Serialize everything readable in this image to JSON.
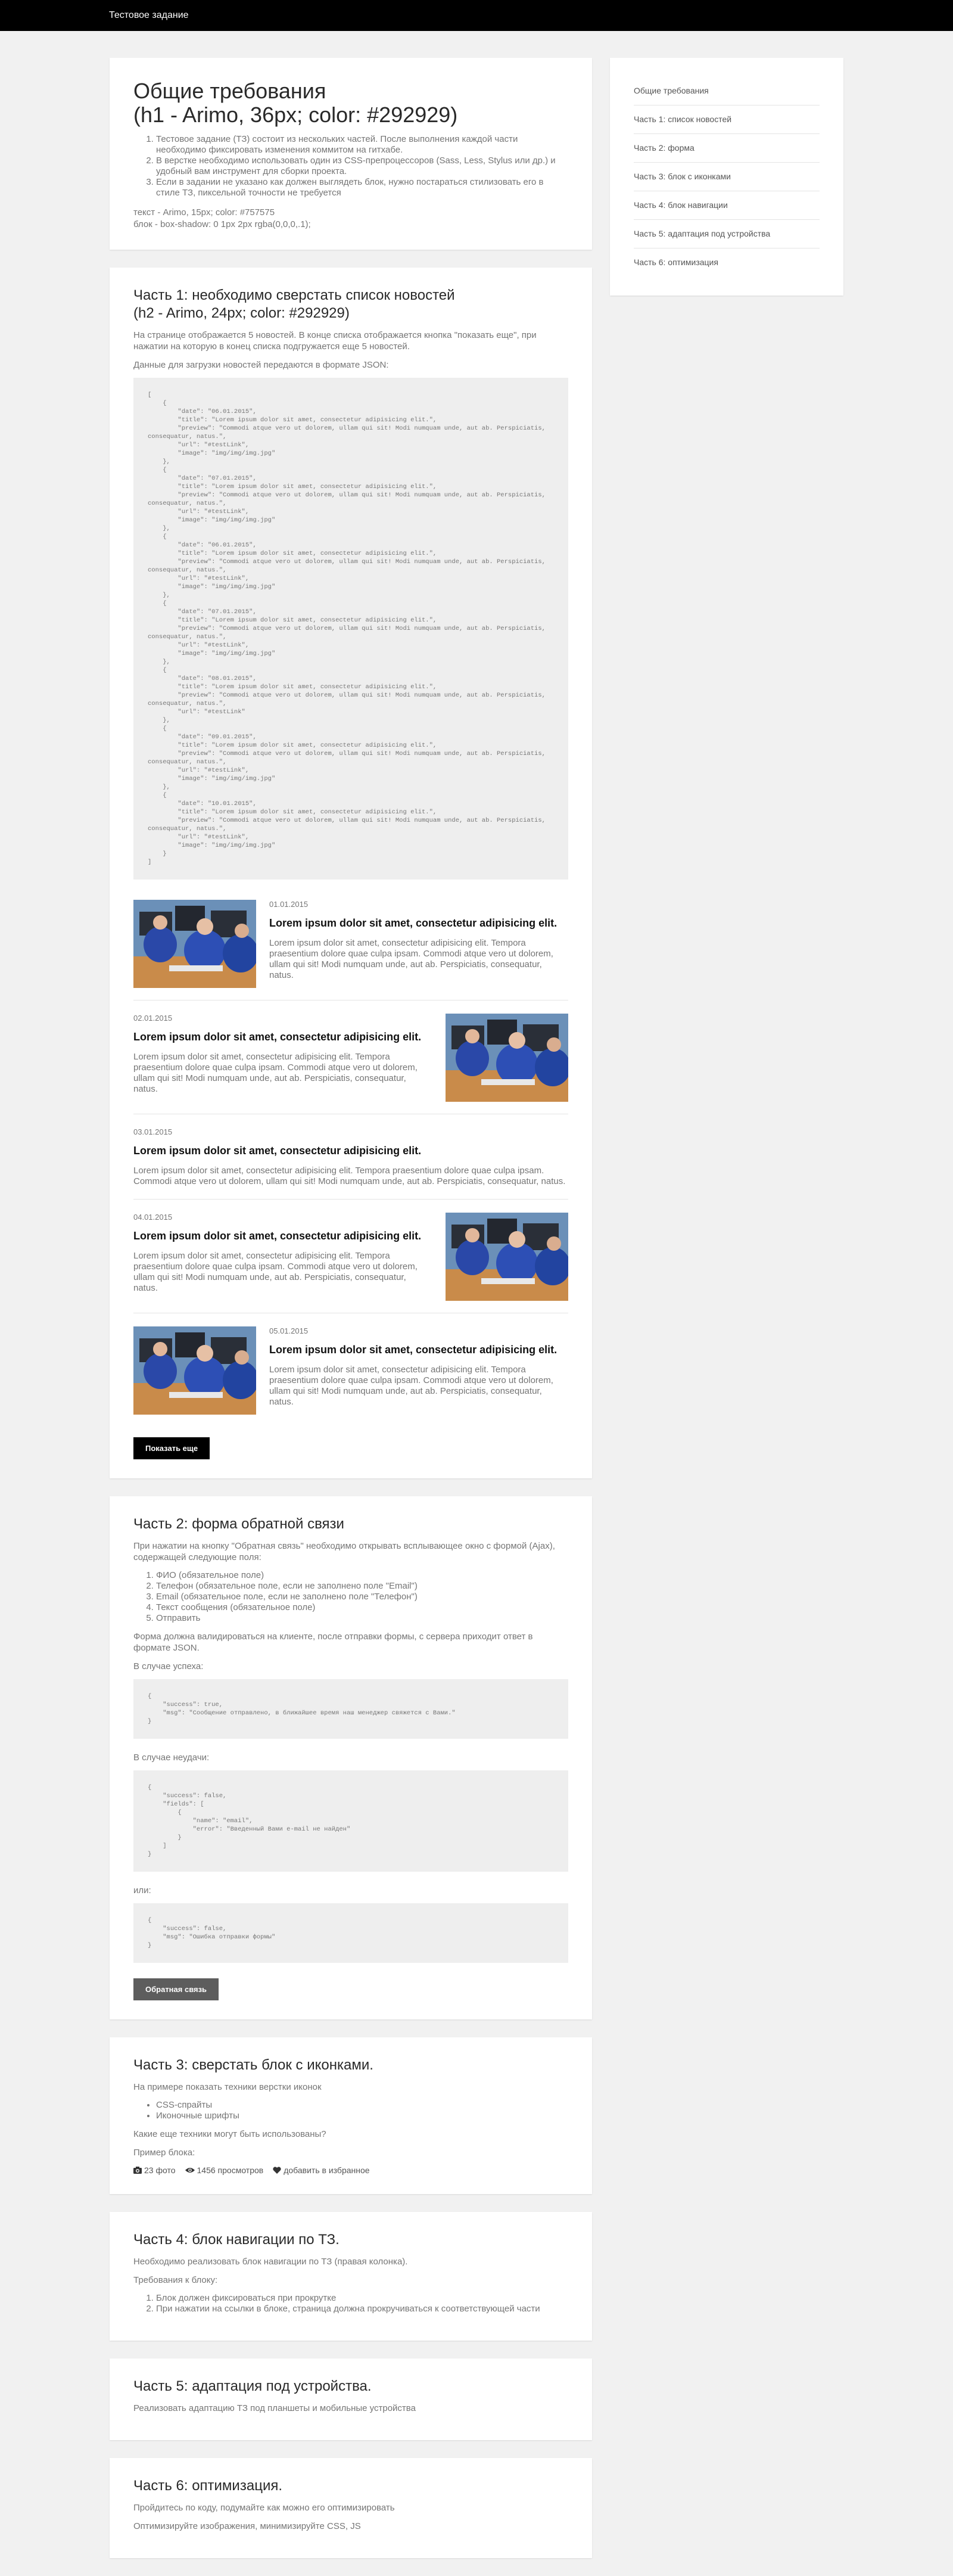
{
  "topbar": {
    "title": "Тестовое задание"
  },
  "general": {
    "title_line1": "Общие требования",
    "title_line2": "(h1 - Arimo, 36px; color: #292929)",
    "items": [
      "Тестовое задание (ТЗ) состоит из нескольких частей. После выполнения каждой части необходимо фиксировать изменения коммитом на гитхабе.",
      "В верстке необходимо использовать один из CSS-препроцессоров (Sass, Less, Stylus или др.) и удобный вам инструмент для сборки проекта.",
      "Если в задании не указано как должен выглядеть блок, нужно постараться стилизовать его в стиле ТЗ, пиксельной точности не требуется"
    ],
    "meta1": "текст - Arimo, 15px; color: #757575",
    "meta2": "блок - box-shadow: 0 1px 2px rgba(0,0,0,.1);"
  },
  "part1": {
    "title_line1": "Часть 1: необходимо сверстать список новостей",
    "title_line2": "(h2 - Arimo, 24px; color: #292929)",
    "p1": "На странице отображается 5 новостей. В конце списка отображается кнопка \"показать еще\", при нажатии на которую в конец списка подгружается еще 5 новостей.",
    "p2": "Данные для загрузки новостей передаются в формате JSON:",
    "code": "[\n    {\n        \"date\": \"06.01.2015\",\n        \"title\": \"Lorem ipsum dolor sit amet, consectetur adipisicing elit.\",\n        \"preview\": \"Commodi atque vero ut dolorem, ullam qui sit! Modi numquam unde, aut ab. Perspiciatis, consequatur, natus.\",\n        \"url\": \"#testLink\",\n        \"image\": \"img/img/img.jpg\"\n    },\n    {\n        \"date\": \"07.01.2015\",\n        \"title\": \"Lorem ipsum dolor sit amet, consectetur adipisicing elit.\",\n        \"preview\": \"Commodi atque vero ut dolorem, ullam qui sit! Modi numquam unde, aut ab. Perspiciatis, consequatur, natus.\",\n        \"url\": \"#testLink\",\n        \"image\": \"img/img/img.jpg\"\n    },\n    {\n        \"date\": \"06.01.2015\",\n        \"title\": \"Lorem ipsum dolor sit amet, consectetur adipisicing elit.\",\n        \"preview\": \"Commodi atque vero ut dolorem, ullam qui sit! Modi numquam unde, aut ab. Perspiciatis, consequatur, natus.\",\n        \"url\": \"#testLink\",\n        \"image\": \"img/img/img.jpg\"\n    },\n    {\n        \"date\": \"07.01.2015\",\n        \"title\": \"Lorem ipsum dolor sit amet, consectetur adipisicing elit.\",\n        \"preview\": \"Commodi atque vero ut dolorem, ullam qui sit! Modi numquam unde, aut ab. Perspiciatis, consequatur, natus.\",\n        \"url\": \"#testLink\",\n        \"image\": \"img/img/img.jpg\"\n    },\n    {\n        \"date\": \"08.01.2015\",\n        \"title\": \"Lorem ipsum dolor sit amet, consectetur adipisicing elit.\",\n        \"preview\": \"Commodi atque vero ut dolorem, ullam qui sit! Modi numquam unde, aut ab. Perspiciatis, consequatur, natus.\",\n        \"url\": \"#testLink\"\n    },\n    {\n        \"date\": \"09.01.2015\",\n        \"title\": \"Lorem ipsum dolor sit amet, consectetur adipisicing elit.\",\n        \"preview\": \"Commodi atque vero ut dolorem, ullam qui sit! Modi numquam unde, aut ab. Perspiciatis, consequatur, natus.\",\n        \"url\": \"#testLink\",\n        \"image\": \"img/img/img.jpg\"\n    },\n    {\n        \"date\": \"10.01.2015\",\n        \"title\": \"Lorem ipsum dolor sit amet, consectetur adipisicing elit.\",\n        \"preview\": \"Commodi atque vero ut dolorem, ullam qui sit! Modi numquam unde, aut ab. Perspiciatis, consequatur, natus.\",\n        \"url\": \"#testLink\",\n        \"image\": \"img/img/img.jpg\"\n    }\n]",
    "news": [
      {
        "date": "01.01.2015",
        "title": "Lorem ipsum dolor sit amet, consectetur adipisicing elit.",
        "text": "Lorem ipsum dolor sit amet, consectetur adipisicing elit. Tempora praesentium dolore quae culpa ipsam. Commodi atque vero ut dolorem, ullam qui sit! Modi numquam unde, aut ab. Perspiciatis, consequatur, natus."
      },
      {
        "date": "02.01.2015",
        "title": "Lorem ipsum dolor sit amet, consectetur adipisicing elit.",
        "text": "Lorem ipsum dolor sit amet, consectetur adipisicing elit. Tempora praesentium dolore quae culpa ipsam. Commodi atque vero ut dolorem, ullam qui sit! Modi numquam unde, aut ab. Perspiciatis, consequatur, natus."
      },
      {
        "date": "03.01.2015",
        "title": "Lorem ipsum dolor sit amet, consectetur adipisicing elit.",
        "text": "Lorem ipsum dolor sit amet, consectetur adipisicing elit. Tempora praesentium dolore quae culpa ipsam. Commodi atque vero ut dolorem, ullam qui sit! Modi numquam unde, aut ab. Perspiciatis, consequatur, natus."
      },
      {
        "date": "04.01.2015",
        "title": "Lorem ipsum dolor sit amet, consectetur adipisicing elit.",
        "text": "Lorem ipsum dolor sit amet, consectetur adipisicing elit. Tempora praesentium dolore quae culpa ipsam. Commodi atque vero ut dolorem, ullam qui sit! Modi numquam unde, aut ab. Perspiciatis, consequatur, natus."
      },
      {
        "date": "05.01.2015",
        "title": "Lorem ipsum dolor sit amet, consectetur adipisicing elit.",
        "text": "Lorem ipsum dolor sit amet, consectetur adipisicing elit. Tempora praesentium dolore quae culpa ipsam. Commodi atque vero ut dolorem, ullam qui sit! Modi numquam unde, aut ab. Perspiciatis, consequatur, natus."
      }
    ],
    "button": "Показать еще"
  },
  "part2": {
    "title": "Часть 2: форма обратной связи",
    "p1": "При нажатии на кнопку \"Обратная связь\" необходимо открывать всплывающее окно с формой (Ajax), содержащей следующие поля:",
    "fields": [
      "ФИО (обязательное поле)",
      "Телефон (обязательное поле, если не заполнено поле \"Email\")",
      "Email (обязательное поле, если не заполнено поле \"Телефон\")",
      "Текст сообщения (обязательное поле)",
      "Отправить"
    ],
    "p2": "Форма должна валидироваться на клиенте, после отправки формы, с сервера приходит ответ в формате JSON.",
    "success_label": "В случае успеха:",
    "code_success": "{\n    \"success\": true,\n    \"msg\": \"Сообщение отправлено, в ближайшее время наш менеджер свяжется с Вами.\"\n}",
    "fail_label": "В случае неудачи:",
    "code_fail": "{\n    \"success\": false,\n    \"fields\": [\n        {\n            \"name\": \"email\",\n            \"error\": \"Введенный Вами e-mail не найден\"\n        }\n    ]\n}",
    "or_label": "или:",
    "code_or": "{\n    \"success\": false,\n    \"msg\": \"Ошибка отправки формы\"\n}",
    "button": "Обратная связь"
  },
  "part3": {
    "title": "Часть 3: сверстать блок с иконками.",
    "p1": "На примере показать техники верстки иконок",
    "items": [
      "CSS-спрайты",
      "Иконочные шрифты"
    ],
    "p2": "Какие еще техники могут быть использованы?",
    "p3": "Пример блока:",
    "icons": [
      {
        "icon": "camera-icon",
        "label": "23 фото"
      },
      {
        "icon": "eye-icon",
        "label": "1456 просмотров"
      },
      {
        "icon": "heart-icon",
        "label": "добавить в избранное"
      }
    ]
  },
  "part4": {
    "title": "Часть 4: блок навигации по ТЗ.",
    "p1": "Необходимо реализовать блок навигации по ТЗ (правая колонка).",
    "p2": "Требования к блоку:",
    "items": [
      "Блок должен фиксироваться при прокрутке",
      "При нажатии на ссылки в блоке, страница должна прокручиваться к соответствующей части"
    ]
  },
  "part5": {
    "title": "Часть 5: адаптация под устройства.",
    "p1": "Реализовать адаптацию ТЗ под планшеты и мобильные устройства"
  },
  "part6": {
    "title": "Часть 6: оптимизация.",
    "p1": "Пройдитесь по коду, подумайте как можно его оптимизировать",
    "p2": "Оптимизируйте изображения, минимизируйте CSS, JS"
  },
  "nav": {
    "items": [
      "Общие требования",
      "Часть 1: список новостей",
      "Часть 2: форма",
      "Часть 3: блок с иконками",
      "Часть 4: блок навигации",
      "Часть 5: адаптация под устройства",
      "Часть 6: оптимизация"
    ]
  }
}
